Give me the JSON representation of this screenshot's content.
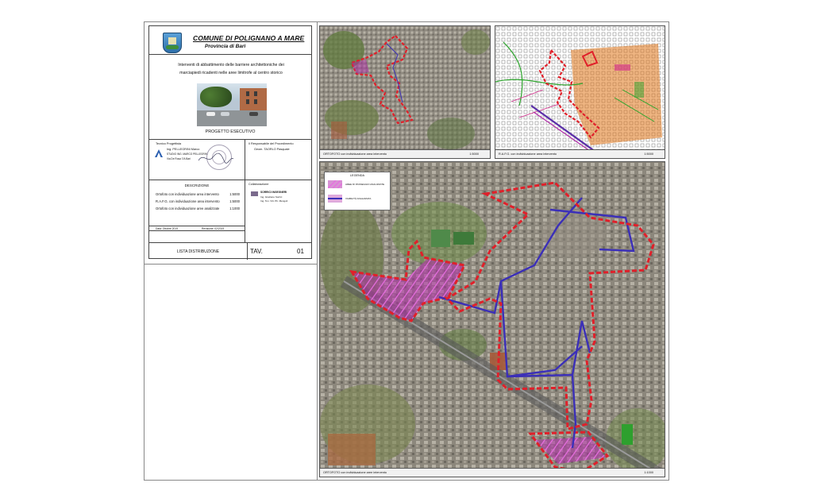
{
  "header": {
    "comune": "COMUNE DI POLIGNANO A MARE",
    "provincia": "Provincia di Bari"
  },
  "subject": {
    "line1": "Interventi di abbattimento delle barriere architettoniche dei",
    "line2": "marciapiedi ricadenti nelle aree limitrofe al centro storico",
    "phase": "PROGETTO ESECUTIVO"
  },
  "technical": {
    "role": "Tecnico Progettista",
    "name": "Ing. PELLEGRINI Marco",
    "studio": "STUDIO ING. MARCO PELLEGRINI",
    "address": "Via De Rosa 7/A  Bari"
  },
  "responsabile": {
    "role": "Il Responsabile del Procedimento",
    "name": "Geom. TAORLO Pasquale"
  },
  "description": {
    "title": "DESCRIZIONE",
    "items": [
      {
        "label": "Ortofoto con individuazione area intervento",
        "scale": "1:5000"
      },
      {
        "label": "R.A.F.G. con individuazione area intervento",
        "scale": "1:5000"
      },
      {
        "label": "Ortofoto con individuazione aree analizzate",
        "scale": "1:1000"
      }
    ],
    "date": "Data: Ottobre 2019",
    "revision": "Revisione: 02/2019"
  },
  "collaborator": {
    "role": "Collaborazione",
    "company": "SORRICI INGEGNERI",
    "line1": "Ing. Graziano Sorrici",
    "line2": "Ing. Ton. Vitt. Pb. Mengoli"
  },
  "footer": {
    "lista": "LISTA DISTRIBUZIONE",
    "tav": "TAV.",
    "tav_number": "01"
  },
  "maps": {
    "ortofoto_small": {
      "caption": "ORTOFOTO con individuazione area intervento",
      "scale": "1:5000"
    },
    "rafg": {
      "caption": "R.A.F.G. con individuazione area intervento",
      "scale": "1:5000"
    },
    "ortofoto_large": {
      "caption": "ORTOFOTO con individuazione aree intervento",
      "scale": "1:1000"
    }
  },
  "legend": {
    "title": "LEGENDA",
    "item1": "AREE DI PASSEGGIO ANALIZZATE",
    "item2": "VIABILITÀ ANALIZZATA"
  },
  "colors": {
    "area": "#b02aa8",
    "boundary": "#e0202a",
    "route": "#3b2fb8"
  }
}
